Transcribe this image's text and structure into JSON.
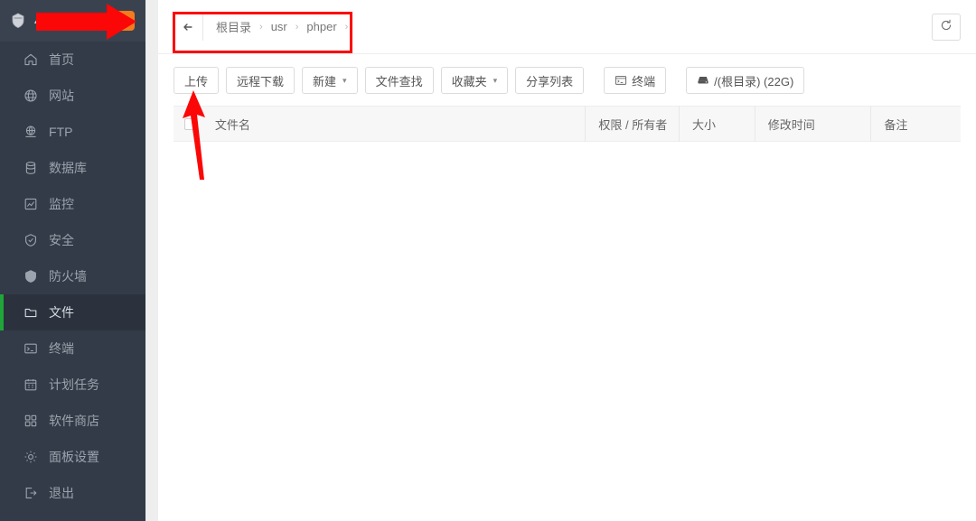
{
  "sidebar": {
    "header": {
      "title": "43.1",
      "logo_icon": "shield-icon",
      "badge": "0"
    },
    "items": [
      {
        "label": "首页",
        "icon": "home-icon",
        "active": false
      },
      {
        "label": "网站",
        "icon": "globe-icon",
        "active": false
      },
      {
        "label": "FTP",
        "icon": "ftp-icon",
        "active": false
      },
      {
        "label": "数据库",
        "icon": "database-icon",
        "active": false
      },
      {
        "label": "监控",
        "icon": "monitor-icon",
        "active": false
      },
      {
        "label": "安全",
        "icon": "shield-check-icon",
        "active": false
      },
      {
        "label": "防火墙",
        "icon": "firewall-icon",
        "active": false
      },
      {
        "label": "文件",
        "icon": "folder-icon",
        "active": true
      },
      {
        "label": "终端",
        "icon": "terminal-icon",
        "active": false
      },
      {
        "label": "计划任务",
        "icon": "calendar-icon",
        "active": false
      },
      {
        "label": "软件商店",
        "icon": "grid-icon",
        "active": false
      },
      {
        "label": "面板设置",
        "icon": "gear-icon",
        "active": false
      },
      {
        "label": "退出",
        "icon": "logout-icon",
        "active": false
      }
    ]
  },
  "breadcrumb": {
    "back_icon": "arrow-left-icon",
    "segments": [
      "根目录",
      "usr",
      "phper"
    ],
    "separator": "›",
    "refresh_icon": "refresh-icon",
    "refresh_label": ""
  },
  "toolbar": {
    "buttons": [
      {
        "label": "上传",
        "icon": "",
        "caret": false
      },
      {
        "label": "远程下载",
        "icon": "",
        "caret": false
      },
      {
        "label": "新建",
        "icon": "",
        "caret": true
      },
      {
        "label": "文件查找",
        "icon": "",
        "caret": false
      },
      {
        "label": "收藏夹",
        "icon": "",
        "caret": true
      },
      {
        "label": "分享列表",
        "icon": "",
        "caret": false
      },
      {
        "label": "终端",
        "icon": "terminal-icon",
        "caret": false
      },
      {
        "label": "/(根目录) (22G)",
        "icon": "disk-icon",
        "caret": false
      }
    ]
  },
  "table": {
    "columns": [
      "文件名",
      "权限 / 所有者",
      "大小",
      "修改时间",
      "备注"
    ],
    "rows": []
  },
  "annotations": {
    "arrow_color": "#fb0707",
    "box_color": "#fb0707",
    "items": [
      {
        "name": "arrow-pointing-to-badge",
        "direction": "right"
      },
      {
        "name": "arrow-pointing-to-upload-button",
        "direction": "up"
      },
      {
        "name": "box-around-breadcrumb",
        "direction": ""
      }
    ]
  },
  "colors": {
    "sidebar_bg": "#333b48",
    "sidebar_active_bg": "#2b323d",
    "accent_green": "#20a53a",
    "badge_orange": "#f37b1d",
    "annotation_red": "#fb0707"
  }
}
